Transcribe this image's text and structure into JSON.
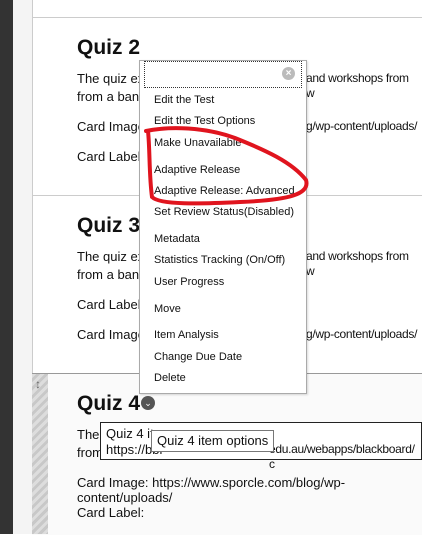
{
  "sections": [
    {
      "title": "Quiz 2",
      "desc_left": "The quiz ex",
      "desc_right": "and workshops from w",
      "desc2": "from a bank",
      "row1": "Card Image",
      "row1_right": "g/wp-content/uploads/",
      "row2": "Card Label"
    },
    {
      "title": "Quiz 3",
      "desc_left": "The quiz ex",
      "desc_right": "and workshops from w",
      "desc2": "from a bank",
      "row1": "Card Label",
      "row2": "Card Image",
      "row2_right": "g/wp-content/uploads/"
    },
    {
      "title": "Quiz 4",
      "desc_left": "The",
      "desc2": "from",
      "card_image": "Card Image: https://www.sporcle.com/blog/wp-content/uploads/",
      "card_label": "Card Label:"
    }
  ],
  "menu": {
    "items": [
      "Edit the Test",
      "Edit the Test Options",
      "Make Unavailable",
      "Adaptive Release",
      "Adaptive Release: Advanced",
      "Set Review Status(Disabled)",
      "Metadata",
      "Statistics Tracking (On/Off)",
      "User Progress",
      "Move",
      "Item Analysis",
      "Change Due Date",
      "Delete"
    ]
  },
  "tooltip": {
    "line1": "Quiz 4 it",
    "line2": "https://bbl",
    "line2_right": "edu.au/webapps/blackboard/c",
    "small": "Quiz 4 item options"
  },
  "annotation_color": "#e0141e"
}
